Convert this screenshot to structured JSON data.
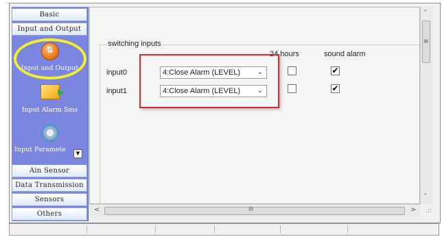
{
  "sidebar": {
    "top_tabs": [
      "Basic",
      "Input and Output"
    ],
    "items": [
      {
        "label": "Input and Output",
        "icon": "input-output-icon"
      },
      {
        "label": "Input Alarm Sms",
        "icon": "envelope-icon"
      },
      {
        "label": "Input Paramete",
        "icon": "gear-icon"
      }
    ],
    "bottom_tabs": [
      "Ain Sensor",
      "Data Transmission",
      "Sensors",
      "Others"
    ],
    "dropdown_glyph": "▼"
  },
  "main": {
    "group_title": "switching inputs",
    "col_24h": "24 hours",
    "col_alarm": "sound alarm",
    "rows": [
      {
        "label": "input0",
        "select": "4:Close Alarm (LEVEL)",
        "h24": false,
        "alarm": true
      },
      {
        "label": "input1",
        "select": "4:Close Alarm (LEVEL)",
        "h24": false,
        "alarm": true
      }
    ]
  },
  "glyphs": {
    "up": "˄",
    "down": "˅",
    "left": "<",
    "right": ">",
    "thumb_v": "≡",
    "thumb_h": "III",
    "check": "✔",
    "grip": ".::",
    "select_arrow": "⌄"
  },
  "colors": {
    "sidebar": "#7b86e0",
    "highlight_ring": "#f5ef2b",
    "annotation_box": "#e0262a"
  }
}
